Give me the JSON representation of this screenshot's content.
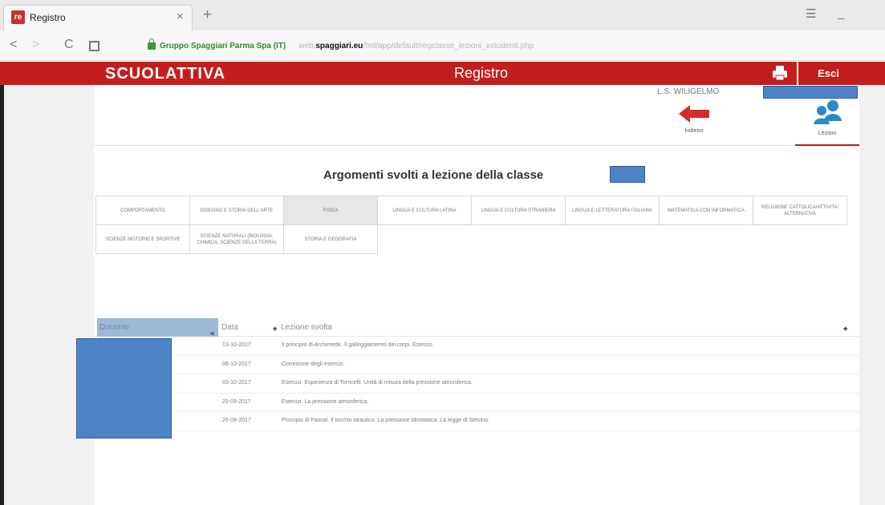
{
  "browser": {
    "tab_title": "Registro",
    "tab_favicon": "re",
    "close_glyph": "×",
    "new_tab_glyph": "+",
    "url_org": "Gruppo Spaggiari Parma Spa (IT)",
    "url_prefix": "web.",
    "url_host": "spaggiari.eu",
    "url_path": "/fml/app/default/regclasse_lezioni_xstudenti.php",
    "back_glyph": "<",
    "forward_glyph": ">",
    "reload_glyph": "C",
    "menu_glyph": "☰",
    "minimize_glyph": "_"
  },
  "header": {
    "logo": "SCUOLATTIVA",
    "title": "Registro",
    "logout_label": "Esci",
    "brand_color": "#c31e1e"
  },
  "school": {
    "name": "L.S. WILIGELMO"
  },
  "toolbar": {
    "back_label": "Indietro",
    "lessons_label": "Lezioni"
  },
  "page_heading": "Argomenti svolti a lezione della classe",
  "subjects": [
    [
      "COMPORTAMENTO",
      "DISEGNO E STORIA DELL'ARTE",
      "FISICA",
      "LINGUA E CULTURA LATINA",
      "LINGUA E CULTURA STRANIERA",
      "LINGUA E LETTERATURA ITALIANA",
      "MATEMATICA CON INFORMATICA",
      "RELIGIONE CATTOLICA/ATTIVITA' ALTERNATIVA"
    ],
    [
      "SCIENZE MOTORIE E SPORTIVE",
      "SCIENZE NATURALI (BIOLOGIA, CHIMICA, SCIENZE DELLA TERRA)",
      "STORIA E GEOGRAFIA"
    ]
  ],
  "table": {
    "headers": {
      "teacher": "Docente",
      "date": "Data",
      "lesson": "Lezione svolta"
    },
    "sort_glyph": "◆",
    "sort_arrow": "◀",
    "rows": [
      {
        "date": "13-10-2017",
        "lesson": "Il principio di Archimede. Il galleggiamento dei corpi. Esercizi."
      },
      {
        "date": "06-10-2017",
        "lesson": "Correzione degli esercizi."
      },
      {
        "date": "03-10-2017",
        "lesson": "Esercizi. Esperienza di Torricelli. Unità di misura della pressione atmosferica."
      },
      {
        "date": "29-09-2017",
        "lesson": "Esercizi. La pressione atmosferica."
      },
      {
        "date": "26-09-2017",
        "lesson": "Principio di Pascal. Il torchio idraulico. La pressione idrostatica. La legge di Stevino."
      }
    ]
  }
}
